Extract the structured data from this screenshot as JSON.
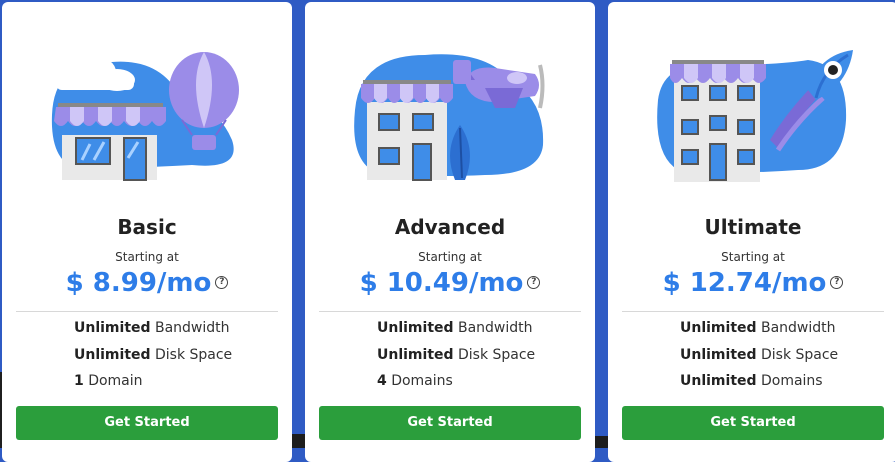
{
  "colors": {
    "page_background": "#2f5bc4",
    "card_background": "#ffffff",
    "price": "#2e7de8",
    "button": "#2b9e3c",
    "illustration_blob": "#3f8de8",
    "awning": "#9b8ce8"
  },
  "icons": {
    "help": "question-mark-circle-icon",
    "basic_illustration": "store-and-hot-air-balloon-illustration",
    "advanced_illustration": "building-and-airplane-illustration",
    "ultimate_illustration": "tall-building-and-rocket-illustration"
  },
  "plans": [
    {
      "title": "Basic",
      "starting": "Starting at",
      "price": "$ 8.99/mo",
      "help": "?",
      "features": [
        {
          "bold": "Unlimited",
          "text": " Bandwidth"
        },
        {
          "bold": "Unlimited",
          "text": " Disk Space"
        },
        {
          "bold": "1",
          "text": " Domain"
        }
      ],
      "button": "Get Started"
    },
    {
      "title": "Advanced",
      "starting": "Starting at",
      "price": "$ 10.49/mo",
      "help": "?",
      "features": [
        {
          "bold": "Unlimited",
          "text": " Bandwidth"
        },
        {
          "bold": "Unlimited",
          "text": " Disk Space"
        },
        {
          "bold": "4",
          "text": " Domains"
        }
      ],
      "button": "Get Started"
    },
    {
      "title": "Ultimate",
      "starting": "Starting at",
      "price": "$ 12.74/mo",
      "help": "?",
      "features": [
        {
          "bold": "Unlimited",
          "text": " Bandwidth"
        },
        {
          "bold": "Unlimited",
          "text": " Disk Space"
        },
        {
          "bold": "Unlimited",
          "text": " Domains"
        }
      ],
      "button": "Get Started"
    }
  ]
}
